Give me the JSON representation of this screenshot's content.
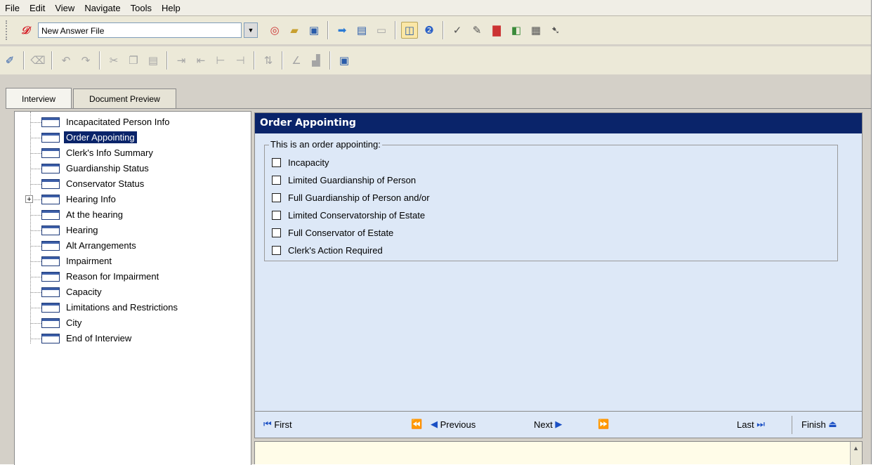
{
  "menu": [
    "File",
    "Edit",
    "View",
    "Navigate",
    "Tools",
    "Help"
  ],
  "toolbar": {
    "answer_file": "New Answer File"
  },
  "tabs": {
    "interview": "Interview",
    "preview": "Document Preview"
  },
  "tree": {
    "items": [
      {
        "label": "Incapacitated Person Info"
      },
      {
        "label": "Order Appointing"
      },
      {
        "label": "Clerk's Info Summary"
      },
      {
        "label": "Guardianship Status"
      },
      {
        "label": "Conservator Status"
      },
      {
        "label": "Hearing Info"
      },
      {
        "label": "At the hearing"
      },
      {
        "label": "Hearing"
      },
      {
        "label": "Alt Arrangements"
      },
      {
        "label": "Impairment"
      },
      {
        "label": "Reason for Impairment"
      },
      {
        "label": "Capacity"
      },
      {
        "label": "Limitations and Restrictions"
      },
      {
        "label": "City"
      },
      {
        "label": "End of Interview"
      }
    ],
    "expander": "+"
  },
  "dialog": {
    "title": "Order Appointing",
    "group_label": "This is an order appointing:",
    "options": [
      "Incapacity",
      "Limited Guardianship of Person",
      "Full Guardianship of Person and/or",
      "Limited Conservatorship of Estate",
      "Full Conservator of Estate",
      "Clerk's Action Required"
    ]
  },
  "nav": {
    "first": "First",
    "previous": "Previous",
    "next": "Next",
    "last": "Last",
    "finish": "Finish"
  }
}
